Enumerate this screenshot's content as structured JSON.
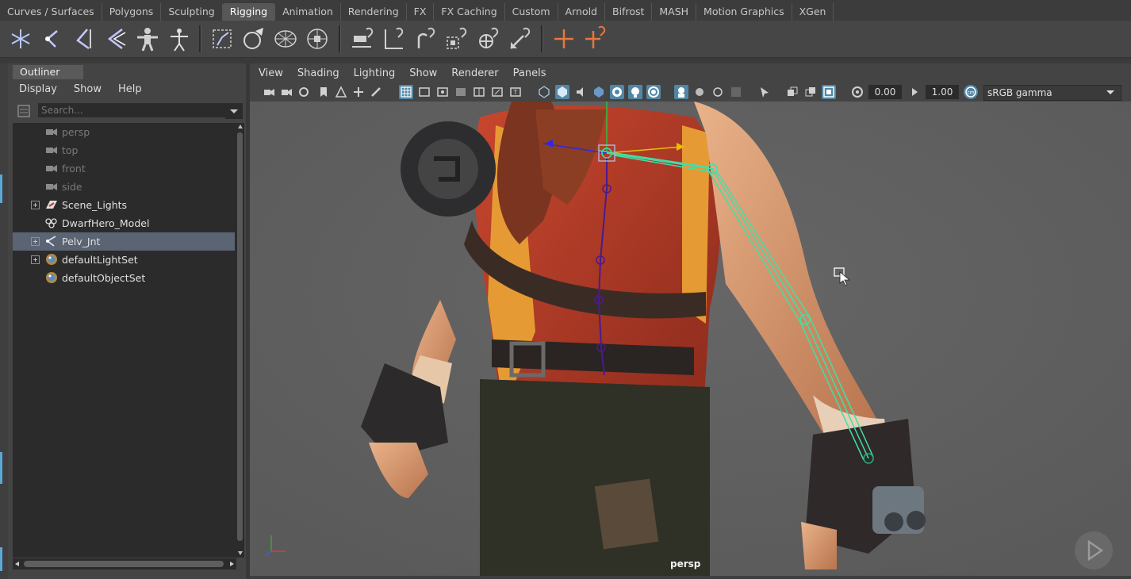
{
  "shelf_tabs": [
    {
      "label": "Curves / Surfaces",
      "active": false
    },
    {
      "label": "Polygons",
      "active": false
    },
    {
      "label": "Sculpting",
      "active": false
    },
    {
      "label": "Rigging",
      "active": true
    },
    {
      "label": "Animation",
      "active": false
    },
    {
      "label": "Rendering",
      "active": false
    },
    {
      "label": "FX",
      "active": false
    },
    {
      "label": "FX Caching",
      "active": false
    },
    {
      "label": "Custom",
      "active": false
    },
    {
      "label": "Arnold",
      "active": false
    },
    {
      "label": "Bifrost",
      "active": false
    },
    {
      "label": "MASH",
      "active": false
    },
    {
      "label": "Motion Graphics",
      "active": false
    },
    {
      "label": "XGen",
      "active": false
    }
  ],
  "shelf_tools": [
    "create-joints-icon",
    "insert-joint-icon",
    "mirror-joint-icon",
    "orient-joint-icon",
    "quick-rig-icon",
    "human-ik-icon",
    "bind-skin-icon",
    "paint-skin-weights-icon",
    "lattice-icon",
    "cluster-icon",
    "ik-handle-icon",
    "ik-spline-icon",
    "parent-constraint-icon",
    "point-constraint-icon",
    "orient-constraint-icon",
    "aim-constraint-icon",
    "pole-vector-icon",
    "scale-constraint-icon"
  ],
  "colors": {
    "accent": "#5286a6",
    "ik_orange": "#e8773a",
    "joint_green": "#40e0a8"
  },
  "outliner": {
    "tab_label": "Outliner",
    "menu": [
      "Display",
      "Show",
      "Help"
    ],
    "search_placeholder": "Search...",
    "items": [
      {
        "label": "persp",
        "icon": "camera-icon",
        "expandable": false,
        "dim": true,
        "selected": false
      },
      {
        "label": "top",
        "icon": "camera-icon",
        "expandable": false,
        "dim": true,
        "selected": false
      },
      {
        "label": "front",
        "icon": "camera-icon",
        "expandable": false,
        "dim": true,
        "selected": false
      },
      {
        "label": "side",
        "icon": "camera-icon",
        "expandable": false,
        "dim": true,
        "selected": false
      },
      {
        "label": "Scene_Lights",
        "icon": "light-group-icon",
        "expandable": true,
        "dim": false,
        "selected": false
      },
      {
        "label": "DwarfHero_Model",
        "icon": "group-icon",
        "expandable": false,
        "dim": false,
        "selected": false
      },
      {
        "label": "Pelv_Jnt",
        "icon": "joint-icon",
        "expandable": true,
        "dim": false,
        "selected": true
      },
      {
        "label": "defaultLightSet",
        "icon": "set-icon",
        "expandable": true,
        "dim": false,
        "selected": false
      },
      {
        "label": "defaultObjectSet",
        "icon": "set-icon",
        "expandable": false,
        "dim": false,
        "selected": false
      }
    ]
  },
  "viewport": {
    "menu": [
      "View",
      "Shading",
      "Lighting",
      "Show",
      "Renderer",
      "Panels"
    ],
    "exposure": "0.00",
    "gamma": "1.00",
    "color_space": "sRGB gamma",
    "camera_label": "persp"
  }
}
